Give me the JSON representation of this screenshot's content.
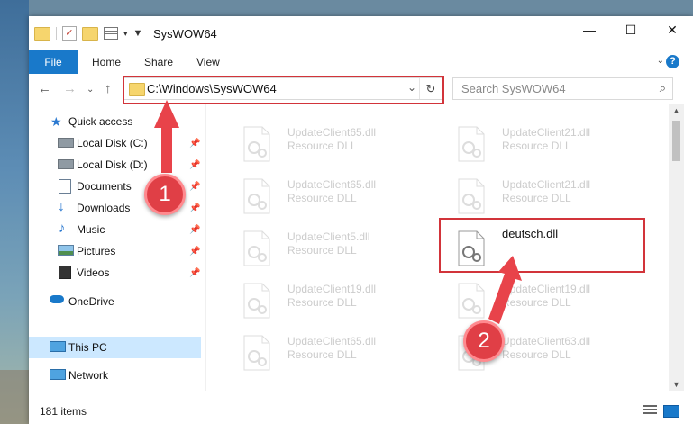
{
  "window": {
    "title": "SysWOW64",
    "controls": {
      "minimize": "—",
      "maximize": "☐",
      "close": "✕"
    }
  },
  "ribbon": {
    "tabs": [
      "File",
      "Home",
      "Share",
      "View"
    ],
    "help": "?"
  },
  "address": {
    "path": "C:\\Windows\\SysWOW64",
    "search_placeholder": "Search SysWOW64"
  },
  "sidebar": {
    "items": [
      {
        "label": "Quick access",
        "icon": "star-icon"
      },
      {
        "label": "Local Disk (C:)",
        "icon": "drive-icon",
        "pinned": true
      },
      {
        "label": "Local Disk (D:)",
        "icon": "drive-icon",
        "pinned": true
      },
      {
        "label": "Documents",
        "icon": "documents-icon",
        "pinned": true
      },
      {
        "label": "Downloads",
        "icon": "download-icon",
        "pinned": true
      },
      {
        "label": "Music",
        "icon": "music-icon",
        "pinned": true
      },
      {
        "label": "Pictures",
        "icon": "pictures-icon",
        "pinned": true
      },
      {
        "label": "Videos",
        "icon": "videos-icon",
        "pinned": true
      },
      {
        "label": "OneDrive",
        "icon": "cloud-icon"
      },
      {
        "label": "This PC",
        "icon": "computer-icon",
        "selected": true
      },
      {
        "label": "Network",
        "icon": "network-icon"
      }
    ]
  },
  "files": [
    {
      "name": "UpdateClient65.dll",
      "type": "Resource DLL"
    },
    {
      "name": "UpdateClient21.dll",
      "type": "Resource DLL"
    },
    {
      "name": "UpdateClient65.dll",
      "type": "Resource DLL"
    },
    {
      "name": "UpdateClient21.dll",
      "type": "Resource DLL"
    },
    {
      "name": "UpdateClient5.dll",
      "type": "Resource DLL"
    },
    {
      "name": "deutsch.dll",
      "type": ""
    },
    {
      "name": "UpdateClient19.dll",
      "type": "Resource DLL"
    },
    {
      "name": "UpdateClient19.dll",
      "type": "Resource DLL"
    },
    {
      "name": "UpdateClient65.dll",
      "type": "Resource DLL"
    },
    {
      "name": "UpdateClient63.dll",
      "type": "Resource DLL"
    }
  ],
  "status": {
    "item_count": "181 items"
  },
  "annotations": {
    "step1": "1",
    "step2": "2",
    "color": "#d2343a"
  }
}
